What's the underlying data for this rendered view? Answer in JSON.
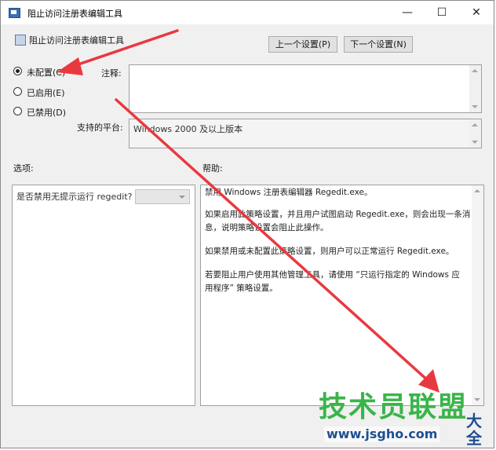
{
  "window": {
    "title": "阻止访问注册表编辑工具",
    "controls": {
      "minimize": "—",
      "maximize": "☐",
      "close": "✕"
    }
  },
  "policy": {
    "name": "阻止访问注册表编辑工具",
    "prev_button": "上一个设置(P)",
    "next_button": "下一个设置(N)"
  },
  "state": {
    "options": [
      {
        "label": "未配置(C)",
        "checked": true
      },
      {
        "label": "已启用(E)",
        "checked": false
      },
      {
        "label": "已禁用(D)",
        "checked": false
      }
    ]
  },
  "comment": {
    "label": "注释:",
    "value": ""
  },
  "platform": {
    "label": "支持的平台:",
    "value": "Windows 2000 及以上版本"
  },
  "options_pane": {
    "label": "选项:",
    "item_label": "是否禁用无提示运行 regedit?",
    "select_value": ""
  },
  "help_pane": {
    "label": "帮助:",
    "paragraphs": [
      "禁用 Windows 注册表编辑器 Regedit.exe。",
      "如果启用此策略设置，并且用户试图启动 Regedit.exe，则会出现一条消",
      "息，说明策略设置会阻止此操作。",
      "如果禁用或未配置此策略设置，则用户可以正常运行 Regedit.exe。",
      "若要阻止用户使用其他管理工具，请使用 “只运行指定的 Windows 应",
      "用程序” 策略设置。"
    ]
  },
  "watermark": {
    "brand": "技术员联盟",
    "suffix": "大全",
    "url": "www.jsgho.com"
  },
  "colors": {
    "annotation_arrow": "#e8393f",
    "watermark_green": "#39b54a",
    "watermark_blue": "#1d4f91"
  }
}
